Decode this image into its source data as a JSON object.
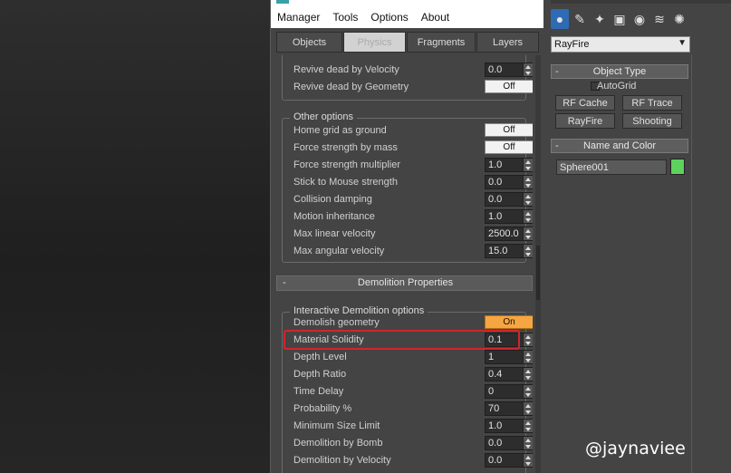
{
  "menu": [
    "Manager",
    "Tools",
    "Options",
    "About"
  ],
  "tabs": [
    "Objects",
    "Physics",
    "Fragments",
    "Layers"
  ],
  "top_rows": [
    {
      "label": "Revive dead by Velocity",
      "type": "spinner",
      "value": "0.0"
    },
    {
      "label": "Revive dead by Geometry",
      "type": "toggle",
      "value": "Off"
    }
  ],
  "other_options": {
    "legend": "Other options",
    "rows": [
      {
        "label": "Home grid as ground",
        "type": "toggle",
        "value": "Off"
      },
      {
        "label": "Force strength by mass",
        "type": "toggle",
        "value": "Off"
      },
      {
        "label": "Force strength multiplier",
        "type": "spinner",
        "value": "1.0"
      },
      {
        "label": "Stick to Mouse strength",
        "type": "spinner",
        "value": "0.0"
      },
      {
        "label": "Collision damping",
        "type": "spinner",
        "value": "0.0"
      },
      {
        "label": "Motion inheritance",
        "type": "spinner",
        "value": "1.0"
      },
      {
        "label": "Max linear velocity",
        "type": "spinner",
        "value": "2500.0"
      },
      {
        "label": "Max angular velocity",
        "type": "spinner",
        "value": "15.0"
      }
    ]
  },
  "demolition": {
    "title": "Demolition Properties",
    "minus": "-",
    "legend": "Interactive Demolition options",
    "rows": [
      {
        "label": "Demolish geometry",
        "type": "toggle",
        "value": "On",
        "on": true
      },
      {
        "label": "Material Solidity",
        "type": "spinner",
        "value": "0.1"
      },
      {
        "label": "Depth Level",
        "type": "spinner",
        "value": "1"
      },
      {
        "label": "Depth Ratio",
        "type": "spinner",
        "value": "0.4"
      },
      {
        "label": "Time Delay",
        "type": "spinner",
        "value": "0"
      },
      {
        "label": "Probability %",
        "type": "spinner",
        "value": "70"
      },
      {
        "label": "Minimum Size Limit",
        "type": "spinner",
        "value": "1.0"
      },
      {
        "label": "Demolition by Bomb",
        "type": "spinner",
        "value": "0.0"
      },
      {
        "label": "Demolition by Velocity",
        "type": "spinner",
        "value": "0.0"
      }
    ]
  },
  "command_panel": {
    "icons": [
      "sphere-icon",
      "shapes-icon",
      "lights-icon",
      "cameras-icon",
      "helpers-icon",
      "spacewarps-icon",
      "systems-icon"
    ],
    "dropdown": "RayFire",
    "object_type": {
      "title": "Object Type",
      "minus": "-",
      "autogrid": "AutoGrid",
      "buttons": [
        "RF Cache",
        "RF Trace",
        "RayFire",
        "Shooting"
      ]
    },
    "name_and_color": {
      "title": "Name and Color",
      "minus": "-",
      "name": "Sphere001",
      "color": "#5ed15e"
    }
  },
  "watermark": "@jaynaviee"
}
